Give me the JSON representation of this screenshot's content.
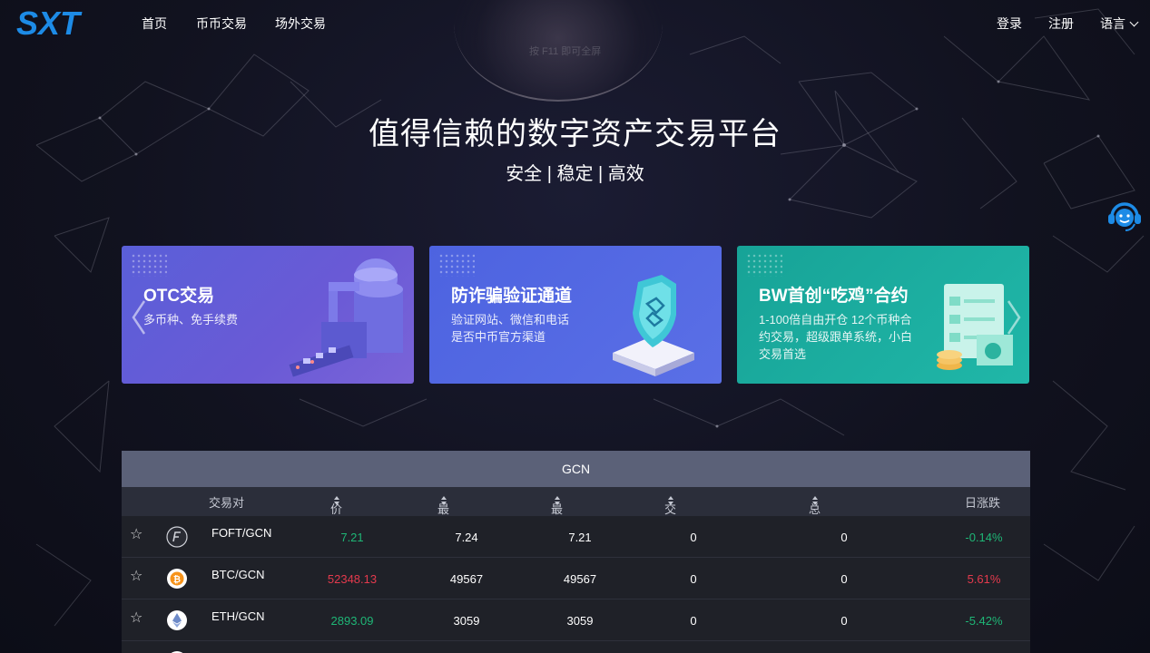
{
  "nav": {
    "items": [
      "首页",
      "币币交易",
      "场外交易"
    ],
    "login": "登录",
    "register": "注册",
    "language": "语言"
  },
  "hero": {
    "title": "值得信赖的数字资产交易平台",
    "subtitle": "安全 | 稳定 | 高效",
    "faint_hint": "按 F11 即可全屏"
  },
  "banners": [
    {
      "title": "OTC交易",
      "desc": "多币种、免手续费"
    },
    {
      "title": "防诈骗验证通道",
      "desc": "验证网站、微信和电话\n是否中币官方渠道"
    },
    {
      "title": "BW首创“吃鸡”合约",
      "desc": "1-100倍自由开仓 12个币种合\n约交易，超级跟单系统，小白\n交易首选"
    }
  ],
  "market": {
    "tab": "GCN",
    "columns": {
      "pair": "交易对",
      "price": "价格",
      "high": "最高价",
      "low": "最低价",
      "volume": "交易量",
      "amount": "总交易额",
      "change": "日涨跌"
    },
    "rows": [
      {
        "pair": "FOFT/GCN",
        "price": "7.21",
        "high": "7.24",
        "low": "7.21",
        "volume": "0",
        "amount": "0",
        "change": "-0.14%",
        "trend": "down"
      },
      {
        "pair": "BTC/GCN",
        "price": "52348.13",
        "high": "49567",
        "low": "49567",
        "volume": "0",
        "amount": "0",
        "change": "5.61%",
        "trend": "up"
      },
      {
        "pair": "ETH/GCN",
        "price": "2893.09",
        "high": "3059",
        "low": "3059",
        "volume": "0",
        "amount": "0",
        "change": "-5.42%",
        "trend": "down"
      }
    ]
  },
  "colors": {
    "up": "#e43a4d",
    "down": "#1fb676",
    "accent": "#1d8be6"
  },
  "logo_text": "SXT"
}
